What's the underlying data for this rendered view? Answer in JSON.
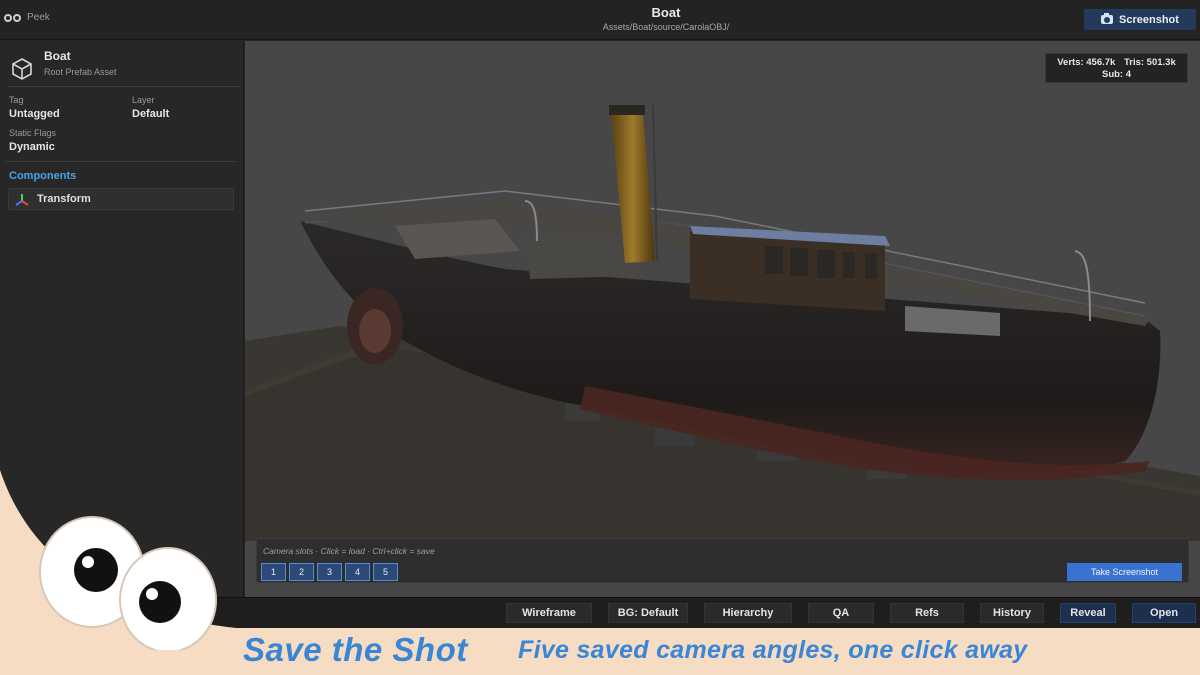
{
  "titlebar": {
    "app_name": "Peek",
    "title": "Boat",
    "path": "Assets/Boat/source/CarolaOBJ/",
    "screenshot_label": "Screenshot"
  },
  "inspector": {
    "asset_name": "Boat",
    "asset_type": "Root Prefab Asset",
    "tag_label": "Tag",
    "tag_value": "Untagged",
    "layer_label": "Layer",
    "layer_value": "Default",
    "static_flags_label": "Static Flags",
    "static_flags_value": "Dynamic",
    "components_label": "Components",
    "components": [
      {
        "label": "Transform"
      }
    ]
  },
  "viewport": {
    "stats_verts": "Verts: 456.7k",
    "stats_tris": "Tris: 501.3k",
    "stats_sub": "Sub: 4",
    "camera_hint": "Camera slots  ·  Click = load  ·  Ctrl+click = save",
    "slots": [
      "1",
      "2",
      "3",
      "4",
      "5"
    ],
    "take_screenshot_label": "Take Screenshot"
  },
  "toolbar": {
    "buttons": [
      {
        "label": "Wireframe"
      },
      {
        "label": "BG: Default"
      },
      {
        "label": "Hierarchy"
      },
      {
        "label": "QA"
      },
      {
        "label": "Refs"
      },
      {
        "label": "History"
      },
      {
        "label": "Reveal"
      },
      {
        "label": "Open"
      }
    ]
  },
  "banner": {
    "title": "Save the Shot",
    "subtitle": "Five saved camera angles, one click away"
  },
  "colors": {
    "accent": "#3a72d2",
    "banner_text": "#3a86d6",
    "banner_bg": "#f6dcc3",
    "components_label": "#4aa3e8"
  }
}
